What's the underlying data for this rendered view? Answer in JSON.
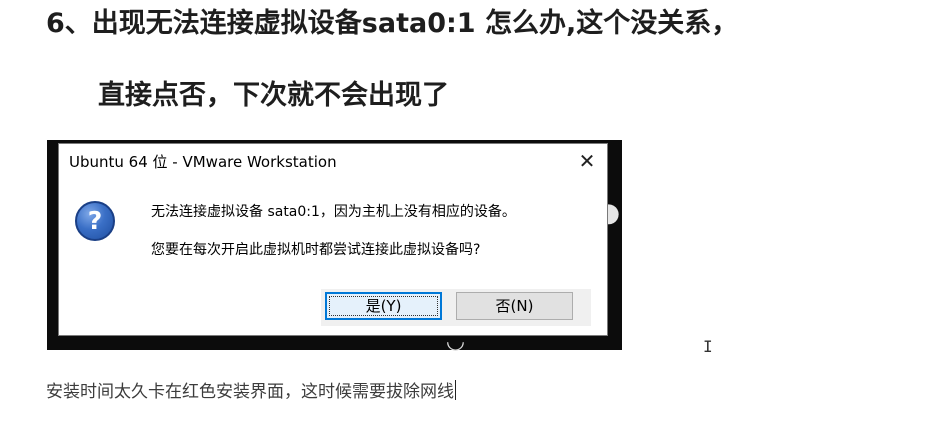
{
  "heading": {
    "line1": "6、出现无法连接虚拟设备sata0:1 怎么办,这个没关系，",
    "line2": "直接点否，下次就不会出现了"
  },
  "dialog": {
    "title": "Ubuntu 64 位 - VMware Workstation",
    "close_label": "✕",
    "icon": "question-icon",
    "icon_glyph": "?",
    "message_line1": "无法连接虚拟设备 sata0:1，因为主机上没有相应的设备。",
    "message_line2": "您要在每次开启此虚拟机时都尝试连接此虚拟设备吗?",
    "yes_label": "是(Y)",
    "no_label": "否(N)"
  },
  "caption": {
    "text": "安装时间太久卡在红色安装界面，这时候需要拔除网线"
  },
  "cursor": {
    "glyph": "I"
  },
  "colors": {
    "frame_background": "#0c0c0c",
    "focused_button_border": "#0078d7",
    "question_icon_blue": "#3a6fc6"
  }
}
